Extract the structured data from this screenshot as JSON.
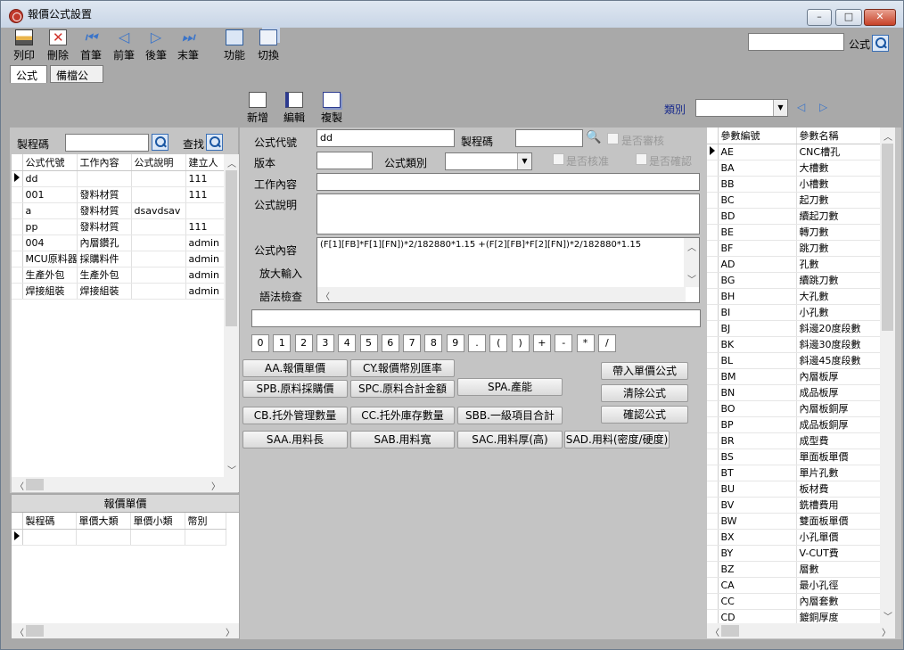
{
  "window": {
    "title": "報價公式設置",
    "minimize": "–",
    "maximize": "□",
    "close": "✕"
  },
  "toolbar": {
    "print": "列印",
    "delete": "刪除",
    "first": "首筆",
    "prev": "前筆",
    "next": "後筆",
    "last": "末筆",
    "function": "功能",
    "switch": "切換",
    "search_value": "",
    "search_label": "公式"
  },
  "tabs": [
    "公式",
    "備檔公式"
  ],
  "actions": {
    "add": "新增",
    "edit": "編輯",
    "copy": "複製",
    "category_label": "類別",
    "category_value": ""
  },
  "left": {
    "process_label": "製程碼",
    "process_value": "",
    "find_label": "查找",
    "headers": [
      "公式代號",
      "工作內容",
      "公式說明",
      "建立人"
    ],
    "rows": [
      [
        "dd",
        "",
        "",
        "111"
      ],
      [
        "001",
        "發料材質",
        "",
        "111"
      ],
      [
        "a",
        "發料材質",
        "dsavdsav",
        ""
      ],
      [
        "pp",
        "發料材質",
        "",
        "111"
      ],
      [
        "004",
        "內層鑽孔",
        "",
        "admin"
      ],
      [
        "MCU原料器",
        "採購料件",
        "",
        "admin"
      ],
      [
        "生產外包",
        "生產外包",
        "",
        "admin"
      ],
      [
        "焊接組裝",
        "焊接組裝",
        "",
        "admin"
      ]
    ],
    "price_caption": "報價單價",
    "price_headers": [
      "製程碼",
      "單價大類",
      "單價小類",
      "幣別"
    ]
  },
  "form": {
    "code_label": "公式代號",
    "code_value": "dd",
    "process_label": "製程碼",
    "process_value": "",
    "audit_label": "是否審核",
    "version_label": "版本",
    "version_value": "",
    "type_label": "公式類別",
    "type_value": "",
    "approve_label": "是否核准",
    "confirm_label": "是否確認",
    "work_label": "工作內容",
    "work_value": "",
    "desc_label": "公式說明",
    "desc_value": "",
    "content_label": "公式內容",
    "content_value": "(F[1][FB]*F[1][FN])*2/182880*1.15 +(F[2][FB]*F[2][FN])*2/182880*1.15",
    "zoom_label": "放大輸入",
    "syntax_label": "語法檢查"
  },
  "calc": {
    "input_value": "",
    "keys": [
      "0",
      "1",
      "2",
      "3",
      "4",
      "5",
      "6",
      "7",
      "8",
      "9",
      ".",
      "(",
      ")",
      "+",
      "-",
      "*",
      "/"
    ],
    "params": [
      "AA.報價單價",
      "CY.報價幣別匯率",
      "SPB.原料採購價",
      "SPC.原料合計金額",
      "SPA.產能",
      "CB.托外管理數量",
      "CC.托外庫存數量",
      "SBB.一級項目合計",
      "SAA.用料長",
      "SAB.用料寬",
      "SAC.用料厚(高)",
      "SAD.用料(密度/硬度)"
    ],
    "bring_price": "帶入單價公式",
    "clear": "清除公式",
    "confirm": "確認公式"
  },
  "right": {
    "headers": [
      "參數編號",
      "參數名稱"
    ],
    "rows": [
      [
        "AE",
        "CNC槽孔"
      ],
      [
        "BA",
        "大槽數"
      ],
      [
        "BB",
        "小槽數"
      ],
      [
        "BC",
        "起刀數"
      ],
      [
        "BD",
        "續起刀數"
      ],
      [
        "BE",
        "轉刀數"
      ],
      [
        "BF",
        "跳刀數"
      ],
      [
        "AD",
        "孔數"
      ],
      [
        "BG",
        "續跳刀數"
      ],
      [
        "BH",
        "大孔數"
      ],
      [
        "BI",
        "小孔數"
      ],
      [
        "BJ",
        "斜邊20度段數"
      ],
      [
        "BK",
        "斜邊30度段數"
      ],
      [
        "BL",
        "斜邊45度段數"
      ],
      [
        "BM",
        "內層板厚"
      ],
      [
        "BN",
        "成品板厚"
      ],
      [
        "BO",
        "內層板銅厚"
      ],
      [
        "BP",
        "成品板銅厚"
      ],
      [
        "BR",
        "成型費"
      ],
      [
        "BS",
        "單面板單價"
      ],
      [
        "BT",
        "單片孔數"
      ],
      [
        "BU",
        "板材費"
      ],
      [
        "BV",
        "銑槽費用"
      ],
      [
        "BW",
        "雙面板單價"
      ],
      [
        "BX",
        "小孔單價"
      ],
      [
        "BY",
        "V-CUT費"
      ],
      [
        "BZ",
        "層數"
      ],
      [
        "CA",
        "最小孔徑"
      ],
      [
        "CC",
        "內層套數"
      ],
      [
        "CD",
        "鍍銅厚度"
      ]
    ]
  }
}
